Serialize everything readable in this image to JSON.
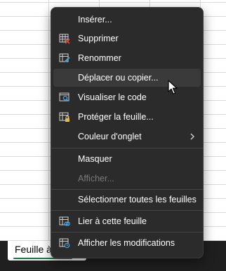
{
  "sheet_tab": {
    "label": "Feuille à"
  },
  "menu": {
    "items": [
      {
        "label": "Insérer...",
        "icon": "none",
        "disabled": false
      },
      {
        "label": "Supprimer",
        "icon": "delete-sheet-icon",
        "disabled": false
      },
      {
        "label": "Renommer",
        "icon": "rename-sheet-icon",
        "disabled": false
      },
      {
        "label": "Déplacer ou copier...",
        "icon": "none",
        "disabled": false,
        "hovered": true
      },
      {
        "label": "Visualiser le code",
        "icon": "view-code-icon",
        "disabled": false
      },
      {
        "label": "Protéger la feuille...",
        "icon": "protect-sheet-icon",
        "disabled": false
      },
      {
        "label": "Couleur d'onglet",
        "icon": "none",
        "disabled": false,
        "submenu": true
      },
      {
        "label": "Masquer",
        "icon": "none",
        "disabled": false
      },
      {
        "label": "Afficher...",
        "icon": "none",
        "disabled": true
      },
      {
        "label": "Sélectionner toutes les feuilles",
        "icon": "none",
        "disabled": false
      },
      {
        "label": "Lier à cette feuille",
        "icon": "link-sheet-icon",
        "disabled": false
      },
      {
        "label": "Afficher les modifications",
        "icon": "show-changes-icon",
        "disabled": false
      }
    ]
  },
  "colors": {
    "menu_bg": "#2b2b2b",
    "hover_bg": "#3a3a3a",
    "text": "#ffffff",
    "disabled_text": "#7a7a7a",
    "accent_red": "#e0433a",
    "accent_blue": "#4aa3df",
    "accent_green": "#107c41"
  }
}
